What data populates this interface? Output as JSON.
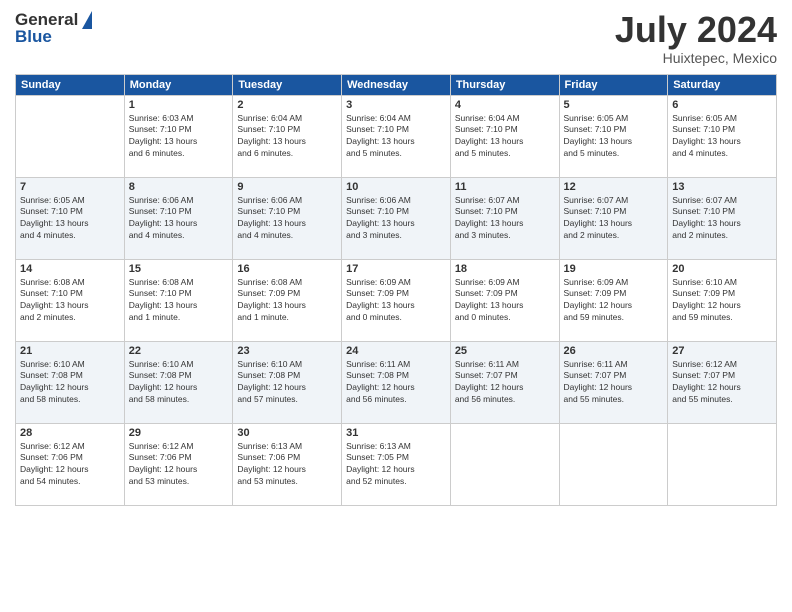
{
  "header": {
    "logo_general": "General",
    "logo_blue": "Blue",
    "month_year": "July 2024",
    "location": "Huixtepec, Mexico"
  },
  "weekdays": [
    "Sunday",
    "Monday",
    "Tuesday",
    "Wednesday",
    "Thursday",
    "Friday",
    "Saturday"
  ],
  "weeks": [
    [
      {
        "day": "",
        "info": ""
      },
      {
        "day": "1",
        "info": "Sunrise: 6:03 AM\nSunset: 7:10 PM\nDaylight: 13 hours\nand 6 minutes."
      },
      {
        "day": "2",
        "info": "Sunrise: 6:04 AM\nSunset: 7:10 PM\nDaylight: 13 hours\nand 6 minutes."
      },
      {
        "day": "3",
        "info": "Sunrise: 6:04 AM\nSunset: 7:10 PM\nDaylight: 13 hours\nand 5 minutes."
      },
      {
        "day": "4",
        "info": "Sunrise: 6:04 AM\nSunset: 7:10 PM\nDaylight: 13 hours\nand 5 minutes."
      },
      {
        "day": "5",
        "info": "Sunrise: 6:05 AM\nSunset: 7:10 PM\nDaylight: 13 hours\nand 5 minutes."
      },
      {
        "day": "6",
        "info": "Sunrise: 6:05 AM\nSunset: 7:10 PM\nDaylight: 13 hours\nand 4 minutes."
      }
    ],
    [
      {
        "day": "7",
        "info": "Sunrise: 6:05 AM\nSunset: 7:10 PM\nDaylight: 13 hours\nand 4 minutes."
      },
      {
        "day": "8",
        "info": "Sunrise: 6:06 AM\nSunset: 7:10 PM\nDaylight: 13 hours\nand 4 minutes."
      },
      {
        "day": "9",
        "info": "Sunrise: 6:06 AM\nSunset: 7:10 PM\nDaylight: 13 hours\nand 4 minutes."
      },
      {
        "day": "10",
        "info": "Sunrise: 6:06 AM\nSunset: 7:10 PM\nDaylight: 13 hours\nand 3 minutes."
      },
      {
        "day": "11",
        "info": "Sunrise: 6:07 AM\nSunset: 7:10 PM\nDaylight: 13 hours\nand 3 minutes."
      },
      {
        "day": "12",
        "info": "Sunrise: 6:07 AM\nSunset: 7:10 PM\nDaylight: 13 hours\nand 2 minutes."
      },
      {
        "day": "13",
        "info": "Sunrise: 6:07 AM\nSunset: 7:10 PM\nDaylight: 13 hours\nand 2 minutes."
      }
    ],
    [
      {
        "day": "14",
        "info": "Sunrise: 6:08 AM\nSunset: 7:10 PM\nDaylight: 13 hours\nand 2 minutes."
      },
      {
        "day": "15",
        "info": "Sunrise: 6:08 AM\nSunset: 7:10 PM\nDaylight: 13 hours\nand 1 minute."
      },
      {
        "day": "16",
        "info": "Sunrise: 6:08 AM\nSunset: 7:09 PM\nDaylight: 13 hours\nand 1 minute."
      },
      {
        "day": "17",
        "info": "Sunrise: 6:09 AM\nSunset: 7:09 PM\nDaylight: 13 hours\nand 0 minutes."
      },
      {
        "day": "18",
        "info": "Sunrise: 6:09 AM\nSunset: 7:09 PM\nDaylight: 13 hours\nand 0 minutes."
      },
      {
        "day": "19",
        "info": "Sunrise: 6:09 AM\nSunset: 7:09 PM\nDaylight: 12 hours\nand 59 minutes."
      },
      {
        "day": "20",
        "info": "Sunrise: 6:10 AM\nSunset: 7:09 PM\nDaylight: 12 hours\nand 59 minutes."
      }
    ],
    [
      {
        "day": "21",
        "info": "Sunrise: 6:10 AM\nSunset: 7:08 PM\nDaylight: 12 hours\nand 58 minutes."
      },
      {
        "day": "22",
        "info": "Sunrise: 6:10 AM\nSunset: 7:08 PM\nDaylight: 12 hours\nand 58 minutes."
      },
      {
        "day": "23",
        "info": "Sunrise: 6:10 AM\nSunset: 7:08 PM\nDaylight: 12 hours\nand 57 minutes."
      },
      {
        "day": "24",
        "info": "Sunrise: 6:11 AM\nSunset: 7:08 PM\nDaylight: 12 hours\nand 56 minutes."
      },
      {
        "day": "25",
        "info": "Sunrise: 6:11 AM\nSunset: 7:07 PM\nDaylight: 12 hours\nand 56 minutes."
      },
      {
        "day": "26",
        "info": "Sunrise: 6:11 AM\nSunset: 7:07 PM\nDaylight: 12 hours\nand 55 minutes."
      },
      {
        "day": "27",
        "info": "Sunrise: 6:12 AM\nSunset: 7:07 PM\nDaylight: 12 hours\nand 55 minutes."
      }
    ],
    [
      {
        "day": "28",
        "info": "Sunrise: 6:12 AM\nSunset: 7:06 PM\nDaylight: 12 hours\nand 54 minutes."
      },
      {
        "day": "29",
        "info": "Sunrise: 6:12 AM\nSunset: 7:06 PM\nDaylight: 12 hours\nand 53 minutes."
      },
      {
        "day": "30",
        "info": "Sunrise: 6:13 AM\nSunset: 7:06 PM\nDaylight: 12 hours\nand 53 minutes."
      },
      {
        "day": "31",
        "info": "Sunrise: 6:13 AM\nSunset: 7:05 PM\nDaylight: 12 hours\nand 52 minutes."
      },
      {
        "day": "",
        "info": ""
      },
      {
        "day": "",
        "info": ""
      },
      {
        "day": "",
        "info": ""
      }
    ]
  ]
}
